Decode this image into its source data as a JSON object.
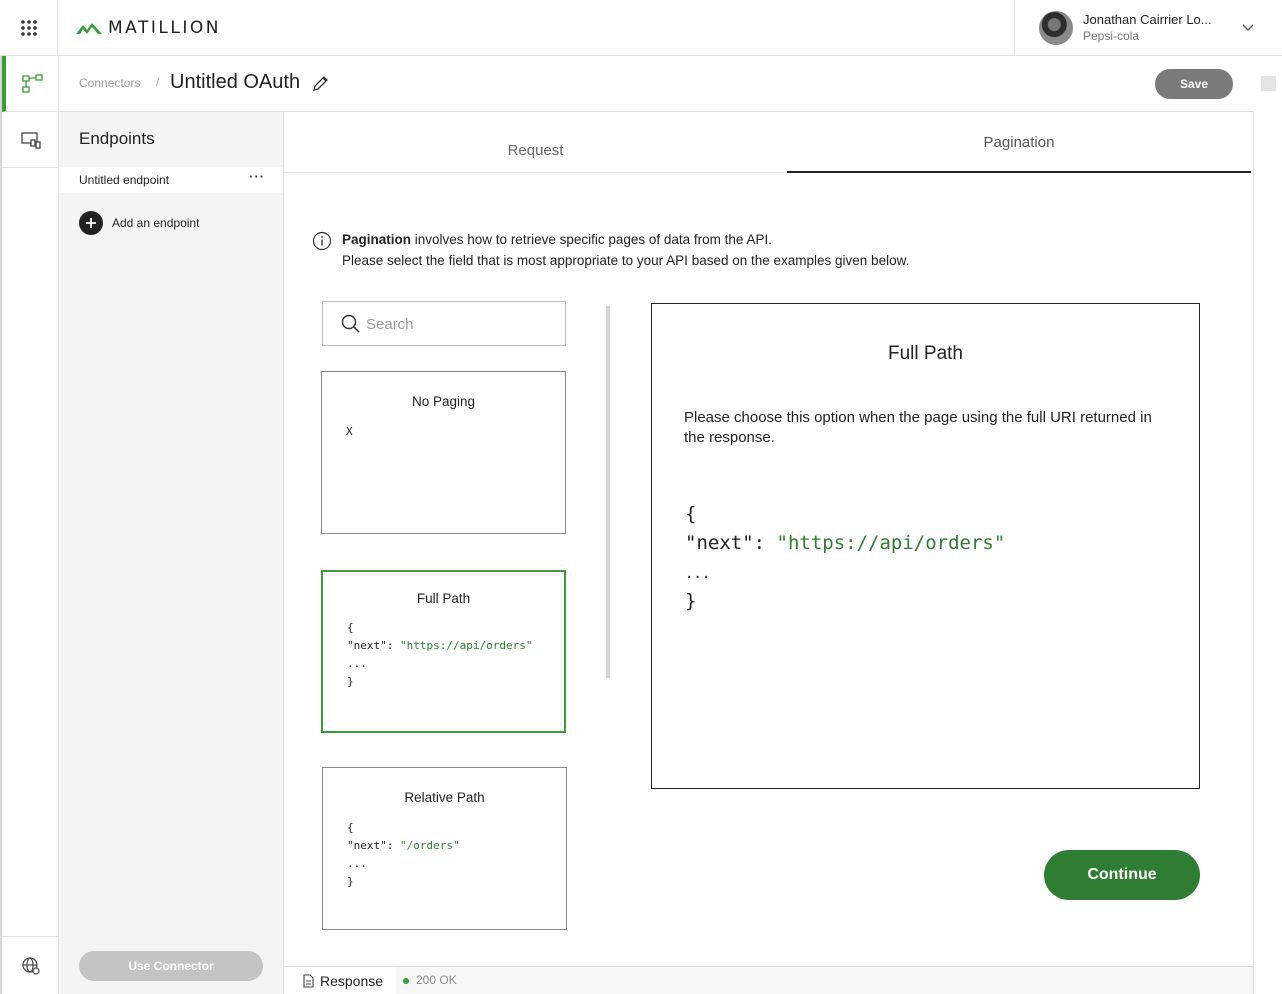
{
  "app": {
    "brand_name": "MATILLION",
    "brand_color": "#3c9b3a"
  },
  "user": {
    "name": "Jonathan Cairrier Lo...",
    "organization": "Pepsi-cola"
  },
  "breadcrumb": {
    "parent": "Connectors",
    "separator": "/",
    "title": "Untitled OAuth"
  },
  "toolbar": {
    "save_label": "Save"
  },
  "endpoints": {
    "heading": "Endpoints",
    "items": [
      {
        "label": "Untitled endpoint",
        "more": "···"
      }
    ],
    "add_label": "Add an endpoint",
    "use_connector_label": "Use Connector"
  },
  "tabs": [
    {
      "label": "Request",
      "active": false
    },
    {
      "label": "Pagination",
      "active": true
    }
  ],
  "info": {
    "bold": "Pagination",
    "line1_rest": " involves how to retrieve specific pages of data from the API.",
    "line2": "Please select the field that is most appropriate to your API based on the examples given below."
  },
  "search": {
    "placeholder": "Search",
    "value": ""
  },
  "options": [
    {
      "title": "No Paging",
      "code": [
        "X"
      ],
      "selected": false
    },
    {
      "title": "Full Path",
      "code_open": "{",
      "code_key": "\"next\"",
      "code_colon": ": ",
      "code_value": "\"https://api/orders\"",
      "code_ellipsis": "...",
      "code_close": "}",
      "selected": true
    },
    {
      "title": "Relative Path",
      "code_open": "{",
      "code_key": "\"next\"",
      "code_colon": ": ",
      "code_value": "\"/orders\"",
      "code_ellipsis": "...",
      "code_close": "}",
      "selected": false
    }
  ],
  "detail": {
    "title": "Full Path",
    "description": "Please choose this option when the page using the full URI returned in the response.",
    "code_open": "{",
    "code_key": "\"next\"",
    "code_colon": ": ",
    "code_value": "\"https://api/orders\"",
    "code_ellipsis": "...",
    "code_close": "}"
  },
  "actions": {
    "continue_label": "Continue"
  },
  "statusbar": {
    "response_label": "Response",
    "status_text": "200 OK",
    "status_color": "#3c9b3a"
  },
  "icons": {
    "apps": "apps-grid-icon",
    "logo": "matillion-logo-icon",
    "chevron": "chevron-down-icon",
    "connectors": "connectors-icon",
    "environments": "environment-icon",
    "globe": "globe-location-icon",
    "edit": "pencil-icon",
    "add": "plus-circle-icon",
    "info": "info-icon",
    "search": "search-icon",
    "response": "document-icon"
  }
}
